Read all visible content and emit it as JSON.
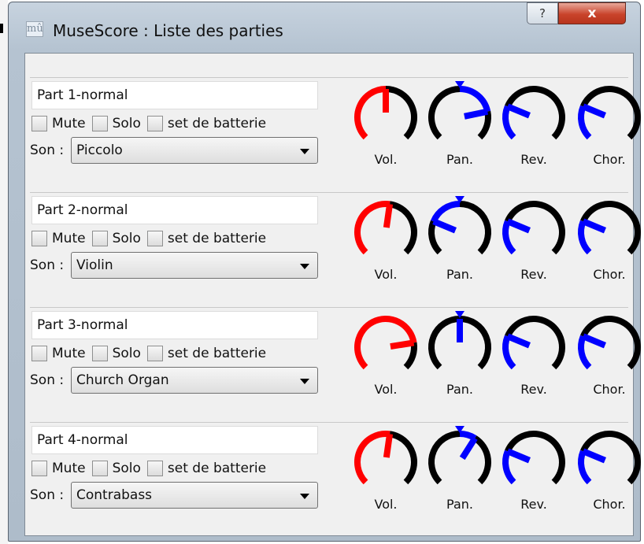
{
  "window": {
    "title": "MuseScore : Liste des parties",
    "app_icon_glyph": "mû",
    "help_label": "?",
    "close_label": "x"
  },
  "labels": {
    "mute": "Mute",
    "solo": "Solo",
    "drumset": "set de batterie",
    "son": "Son :",
    "vol": "Vol.",
    "pan": "Pan.",
    "rev": "Rev.",
    "chor": "Chor."
  },
  "colors": {
    "volume": "#ff0000",
    "effect": "#0000ff",
    "track": "#000000"
  },
  "parts": [
    {
      "name": "Part 1-normal",
      "sound": "Piccolo",
      "volume": 0.5,
      "pan": 0.79,
      "reverb": 0.25,
      "chorus": 0.25
    },
    {
      "name": "Part 2-normal",
      "sound": "Violin",
      "volume": 0.53,
      "pan": 0.25,
      "reverb": 0.25,
      "chorus": 0.25
    },
    {
      "name": "Part 3-normal",
      "sound": "Church Organ",
      "volume": 0.8,
      "pan": 0.5,
      "reverb": 0.25,
      "chorus": 0.25
    },
    {
      "name": "Part 4-normal",
      "sound": "Contrabass",
      "volume": 0.53,
      "pan": 0.62,
      "reverb": 0.25,
      "chorus": 0.25
    }
  ]
}
